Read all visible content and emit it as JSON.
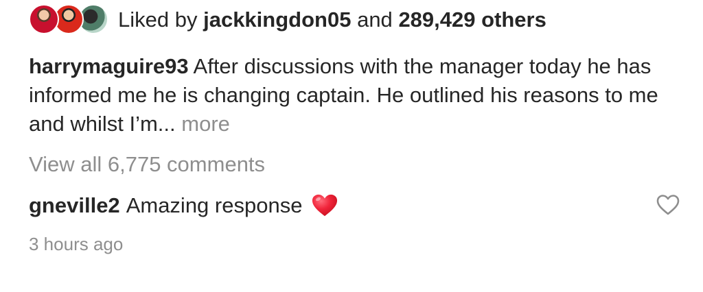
{
  "likes": {
    "prefix": "Liked by",
    "username": "jackkingdon05",
    "connector": "and",
    "count": "289,429 others"
  },
  "caption": {
    "username": "harrymaguire93",
    "text": "After discussions with the manager today he has informed me he is changing captain. He outlined his reasons to me and whilst I’m...",
    "more_label": "more"
  },
  "view_comments_label": "View all 6,775 comments",
  "comment": {
    "username": "gneville2",
    "text": "Amazing response",
    "emoji_icon": "red-heart-emoji",
    "like_icon": "heart-outline-icon"
  },
  "timestamp": "3 hours ago",
  "colors": {
    "text_primary": "#262626",
    "text_secondary": "#8e8e8e",
    "heart_red": "#e0245e"
  }
}
